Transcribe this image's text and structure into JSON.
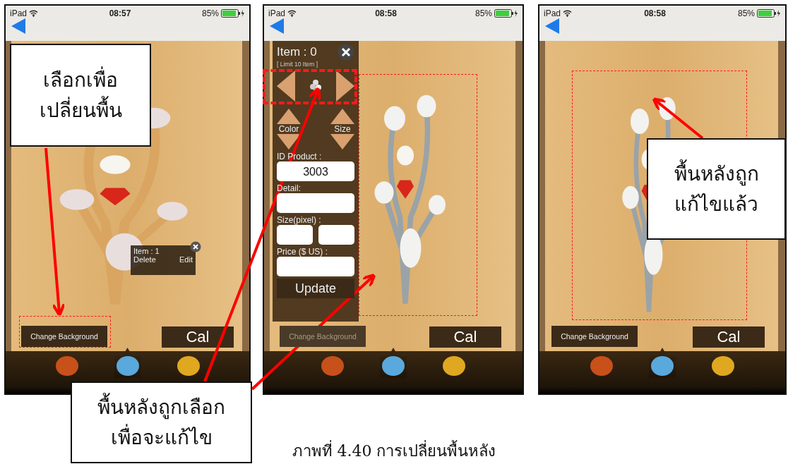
{
  "screens": [
    {
      "status_bar": {
        "device": "iPad",
        "time": "08:57",
        "battery": "85%"
      },
      "product": {
        "kind": "gold-brooch"
      },
      "product_highlighted": false,
      "item_popup": {
        "title": "Item : 1",
        "actions": [
          "Delete",
          "Edit"
        ]
      },
      "change_background": {
        "label": "Change Background",
        "highlighted": true,
        "dimmed": false
      },
      "cal": "Cal",
      "gems": [
        {
          "color": "#c8501a",
          "selected": false
        },
        {
          "color": "#5aa9dc",
          "selected": true
        },
        {
          "color": "#e0a820",
          "selected": false
        }
      ]
    },
    {
      "status_bar": {
        "device": "iPad",
        "time": "08:58",
        "battery": "85%"
      },
      "product": {
        "kind": "silver-brooch"
      },
      "product_highlighted": true,
      "editor_panel": {
        "title": "Item : 0",
        "limit": "[ Limit 10 Item ]",
        "thumbnail_highlighted": true,
        "color_label": "Color",
        "size_label": "Size",
        "id_label": "ID Product :",
        "id_value": "3003",
        "detail_label": "Detail:",
        "size_pixel_label": "Size(pixel) :",
        "price_label": "Price ($ US) :",
        "update": "Update"
      },
      "change_background": {
        "label": "Change Background",
        "highlighted": false,
        "dimmed": true
      },
      "cal": "Cal",
      "gems": [
        {
          "color": "#c8501a",
          "selected": false
        },
        {
          "color": "#5aa9dc",
          "selected": true
        },
        {
          "color": "#e0a820",
          "selected": false
        }
      ]
    },
    {
      "status_bar": {
        "device": "iPad",
        "time": "08:58",
        "battery": "85%"
      },
      "product": {
        "kind": "silver-brooch"
      },
      "product_highlighted": true,
      "change_background": {
        "label": "Change Background",
        "highlighted": false,
        "dimmed": false
      },
      "cal": "Cal",
      "gems": [
        {
          "color": "#c8501a",
          "selected": false
        },
        {
          "color": "#5aa9dc",
          "selected": true
        },
        {
          "color": "#e0a820",
          "selected": false
        }
      ]
    }
  ],
  "callouts": [
    {
      "lines": [
        "เลือกเพื่อ",
        "เปลี่ยนพื้น"
      ]
    },
    {
      "lines": [
        "พื้นหลังถูกเลือก",
        "เพื่อจะแก้ไข"
      ]
    },
    {
      "lines": [
        "พื้นหลังถูก",
        "แก้ไขแล้ว"
      ]
    }
  ],
  "caption": "ภาพที่ 4.40 การเปลี่ยนพื้นหลัง"
}
